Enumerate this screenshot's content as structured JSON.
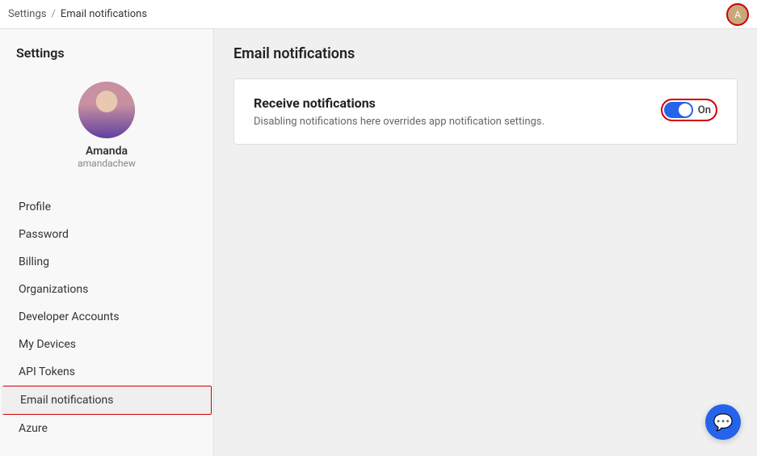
{
  "topbar": {
    "breadcrumb_root": "Settings",
    "breadcrumb_sep": "/",
    "breadcrumb_current": "Email notifications"
  },
  "sidebar": {
    "title": "Settings",
    "user": {
      "name": "Amanda",
      "handle": "amandachew"
    },
    "nav_items": [
      {
        "id": "profile",
        "label": "Profile",
        "active": false
      },
      {
        "id": "password",
        "label": "Password",
        "active": false
      },
      {
        "id": "billing",
        "label": "Billing",
        "active": false
      },
      {
        "id": "organizations",
        "label": "Organizations",
        "active": false
      },
      {
        "id": "developer-accounts",
        "label": "Developer Accounts",
        "active": false
      },
      {
        "id": "my-devices",
        "label": "My Devices",
        "active": false
      },
      {
        "id": "api-tokens",
        "label": "API Tokens",
        "active": false
      },
      {
        "id": "email-notifications",
        "label": "Email notifications",
        "active": true
      },
      {
        "id": "azure",
        "label": "Azure",
        "active": false
      }
    ]
  },
  "main": {
    "title": "Email notifications",
    "card": {
      "title": "Receive notifications",
      "description": "Disabling notifications here overrides app notification settings.",
      "toggle_label": "On",
      "toggle_on": true
    }
  }
}
